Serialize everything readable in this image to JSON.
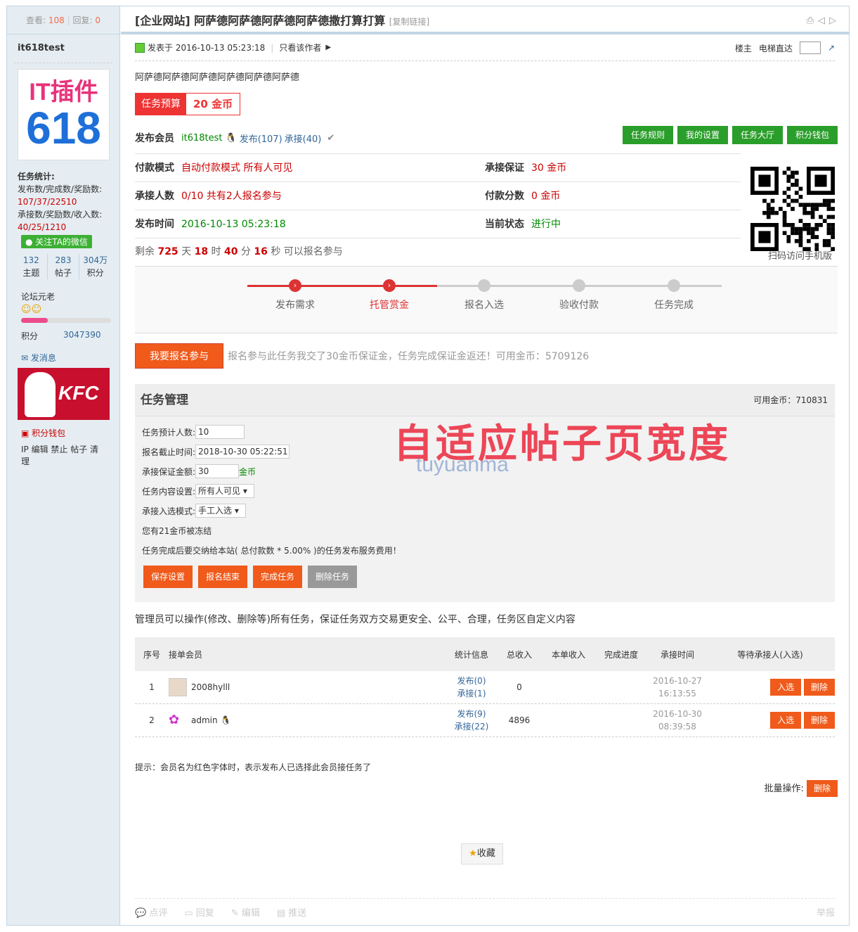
{
  "side": {
    "view_label": "查看:",
    "view_count": "108",
    "reply_label": "回复:",
    "reply_count": "0",
    "username": "it618test",
    "avatar_line1": "IT插件",
    "avatar_line2": "618",
    "task_stats_title": "任务统计:",
    "pub_label": "发布数/完成数/奖励数:",
    "pub_values": "107/37/22510",
    "acc_label": "承接数/奖励数/收入数:",
    "acc_values": "40/25/1210",
    "wechat": "关注TA的微信",
    "stats": [
      {
        "n": "132",
        "l": "主题"
      },
      {
        "n": "283",
        "l": "帖子"
      },
      {
        "n": "304万",
        "l": "积分"
      }
    ],
    "level": "论坛元老",
    "level_progress_fraction": 0.3,
    "points_label": "积分",
    "points_value": "3047390",
    "msg": "发消息",
    "kfc": "KFC",
    "wallet": "积分钱包",
    "ops": "IP 编辑 禁止 帖子 清理"
  },
  "thread": {
    "title": "[企业网站] 阿萨德阿萨德阿萨德阿萨德撒打算打算",
    "copy_link": "[复制链接]",
    "posted": "发表于 2016-10-13 05:23:18",
    "only_author": "只看该作者",
    "floor": "楼主",
    "elevator": "电梯直达",
    "content": "阿萨德阿萨德阿萨德阿萨德阿萨德阿萨德"
  },
  "task": {
    "budget_label": "任务预算",
    "budget_value": "20 金币",
    "member_label": "发布会员",
    "member_name": "it618test",
    "member_pub": "发布(107)",
    "member_acc": "承接(40)",
    "buttons": [
      "任务规则",
      "我的设置",
      "任务大厅",
      "积分钱包"
    ],
    "rows": [
      [
        {
          "k": "付款模式",
          "v": "自动付款模式 所有人可见"
        },
        {
          "k": "承接保证",
          "v": "30 金币"
        }
      ],
      [
        {
          "k": "承接人数",
          "v": "0/10 共有2人报名参与"
        },
        {
          "k": "付款分数",
          "v": "0 金币"
        }
      ],
      [
        {
          "k": "发布时间",
          "v": "2016-10-13 05:23:18"
        },
        {
          "k": "当前状态",
          "v": "进行中"
        }
      ]
    ],
    "qr_caption": "扫码访问手机版",
    "remain_prefix": "剩余",
    "remain_days": "725",
    "remain_days_u": "天",
    "remain_hours": "18",
    "remain_hours_u": "时",
    "remain_min": "40",
    "remain_min_u": "分",
    "remain_sec": "16",
    "remain_sec_u": "秒 可以报名参与",
    "steps": [
      "发布需求",
      "托管赏金",
      "报名入选",
      "验收付款",
      "任务完成"
    ],
    "join_btn": "我要报名参与",
    "join_text": "报名参与此任务我交了30金币保证金，任务完成保证金返还！可用金币：5709126"
  },
  "mgmt": {
    "title": "任务管理",
    "avail": "可用金币：710831",
    "f1_label": "任务预计人数:",
    "f1_value": "10",
    "f2_label": "报名截止时间:",
    "f2_value": "2018-10-30 05:22:51",
    "f3_label": "承接保证金额:",
    "f3_value": "30",
    "f3_unit": "金币",
    "f4_label": "任务内容设置:",
    "f4_value": "所有人可见",
    "f5_label": "承接入选模式:",
    "f5_value": "手工入选",
    "frozen": "您有21金币被冻结",
    "fee": "任务完成后要交纳给本站( 总付款数 * 5.00% )的任务发布服务费用！",
    "buttons": [
      "保存设置",
      "报名结束",
      "完成任务",
      "删除任务"
    ],
    "watermark": "自适应帖子页宽度",
    "watermark2": "tuyuanma"
  },
  "admin_note_red": "管理员可以操作(修改、删除等)所有任务，保证任务双方交易更安全、公平、合理，",
  "admin_note_black": "任务区自定义内容",
  "table": {
    "headers": [
      "序号",
      "接单会员",
      "统计信息",
      "总收入",
      "本单收入",
      "完成进度",
      "承接时间",
      "等待承接人(入选)"
    ],
    "rows": [
      {
        "no": "1",
        "name": "2008hylll",
        "pub": "发布(0)",
        "acc": "承接(1)",
        "total": "0",
        "date": "2016-10-27",
        "time": "16:13:55",
        "b1": "入选",
        "b2": "删除"
      },
      {
        "no": "2",
        "name": "admin",
        "pub": "发布(9)",
        "acc": "承接(22)",
        "total": "4896",
        "date": "2016-10-30",
        "time": "08:39:58",
        "b1": "入选",
        "b2": "删除"
      }
    ]
  },
  "hint": "提示：会员名为红色字体时，表示发布人已选择此会员接任务了",
  "batch_label": "批量操作:",
  "batch_btn": "删除",
  "fav": "收藏",
  "footer": [
    "点评",
    "回复",
    "编辑",
    "推送"
  ],
  "report": "举报"
}
